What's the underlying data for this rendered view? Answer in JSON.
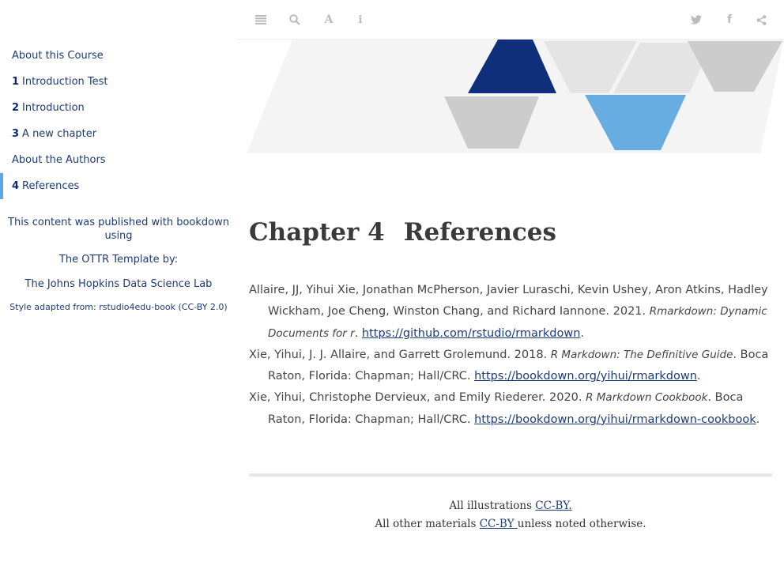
{
  "sidebar": {
    "toc": [
      {
        "num": "",
        "label": "About this Course"
      },
      {
        "num": "1",
        "label": "Introduction Test"
      },
      {
        "num": "2",
        "label": "Introduction"
      },
      {
        "num": "3",
        "label": "A new chapter"
      },
      {
        "num": "",
        "label": "About the Authors"
      },
      {
        "num": "4",
        "label": "References"
      }
    ],
    "published_line": "This content was published with bookdown using",
    "template_line": "The OTTR Template by:",
    "lab_line": "The Johns Hopkins Data Science Lab",
    "style_line": "Style adapted from: rstudio4edu-book (CC-BY 2.0)"
  },
  "toolbar": {
    "icons": [
      "menu-icon",
      "search-icon",
      "font-icon",
      "info-icon",
      "twitter-icon",
      "facebook-icon",
      "share-icon"
    ]
  },
  "colors": {
    "accent": "#1d3b75",
    "active_bar": "#5aa6e8",
    "banner_dark": "#0f2f7a",
    "banner_light": "#67ade2",
    "banner_gray": "#cccccc"
  },
  "main": {
    "chapter_number": "Chapter 4",
    "chapter_title": "References",
    "references": [
      {
        "text": "Allaire, JJ, Yihui Xie, Jonathan McPherson, Javier Luraschi, Kevin Ushey, Aron Atkins, Hadley Wickham, Joe Cheng, Winston Chang, and Richard Iannone. 2021. ",
        "title": "Rmarkdown: Dynamic Documents for r",
        "after": ". ",
        "url": "https://github.com/rstudio/rmarkdown",
        "end": "."
      },
      {
        "text": "Xie, Yihui, J. J. Allaire, and Garrett Grolemund. 2018. ",
        "title": "R Markdown: The Definitive Guide",
        "after": ". Boca Raton, Florida: Chapman; Hall/CRC. ",
        "url": "https://bookdown.org/yihui/rmarkdown",
        "end": "."
      },
      {
        "text": "Xie, Yihui, Christophe Dervieux, and Emily Riederer. 2020. ",
        "title": "R Markdown Cookbook",
        "after": ". Boca Raton, Florida: Chapman; Hall/CRC. ",
        "url": "https://bookdown.org/yihui/rmarkdown-cookbook",
        "end": "."
      }
    ]
  },
  "footer": {
    "illustrations_prefix": "All illustrations ",
    "illustrations_link": "CC-BY.",
    "materials_prefix": "All other materials ",
    "materials_link": "CC-BY ",
    "materials_suffix": "unless noted otherwise."
  }
}
